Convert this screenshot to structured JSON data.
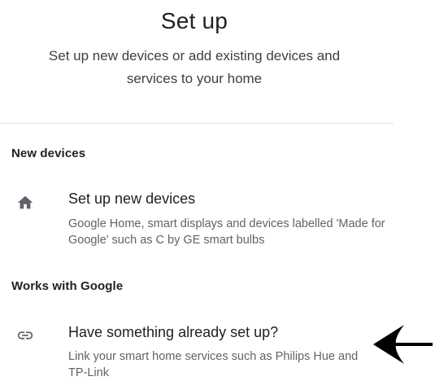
{
  "header": {
    "title": "Set up",
    "subtitle": "Set up new devices or add existing devices and services to your home"
  },
  "sections": [
    {
      "header": "New devices",
      "item": {
        "icon": "home-icon",
        "title": "Set up new devices",
        "description": "Google Home, smart displays and devices labelled 'Made for Google' such as C by GE smart bulbs"
      }
    },
    {
      "header": "Works with Google",
      "item": {
        "icon": "link-icon",
        "title": "Have something already set up?",
        "description": "Link your smart home services such as Philips Hue and TP-Link"
      }
    }
  ],
  "annotation": {
    "icon": "left-arrow-icon",
    "color": "#000000"
  },
  "colors": {
    "text_primary": "#202124",
    "text_secondary": "#5f6368",
    "icon": "#5f6368",
    "divider": "#e0e0e0"
  }
}
